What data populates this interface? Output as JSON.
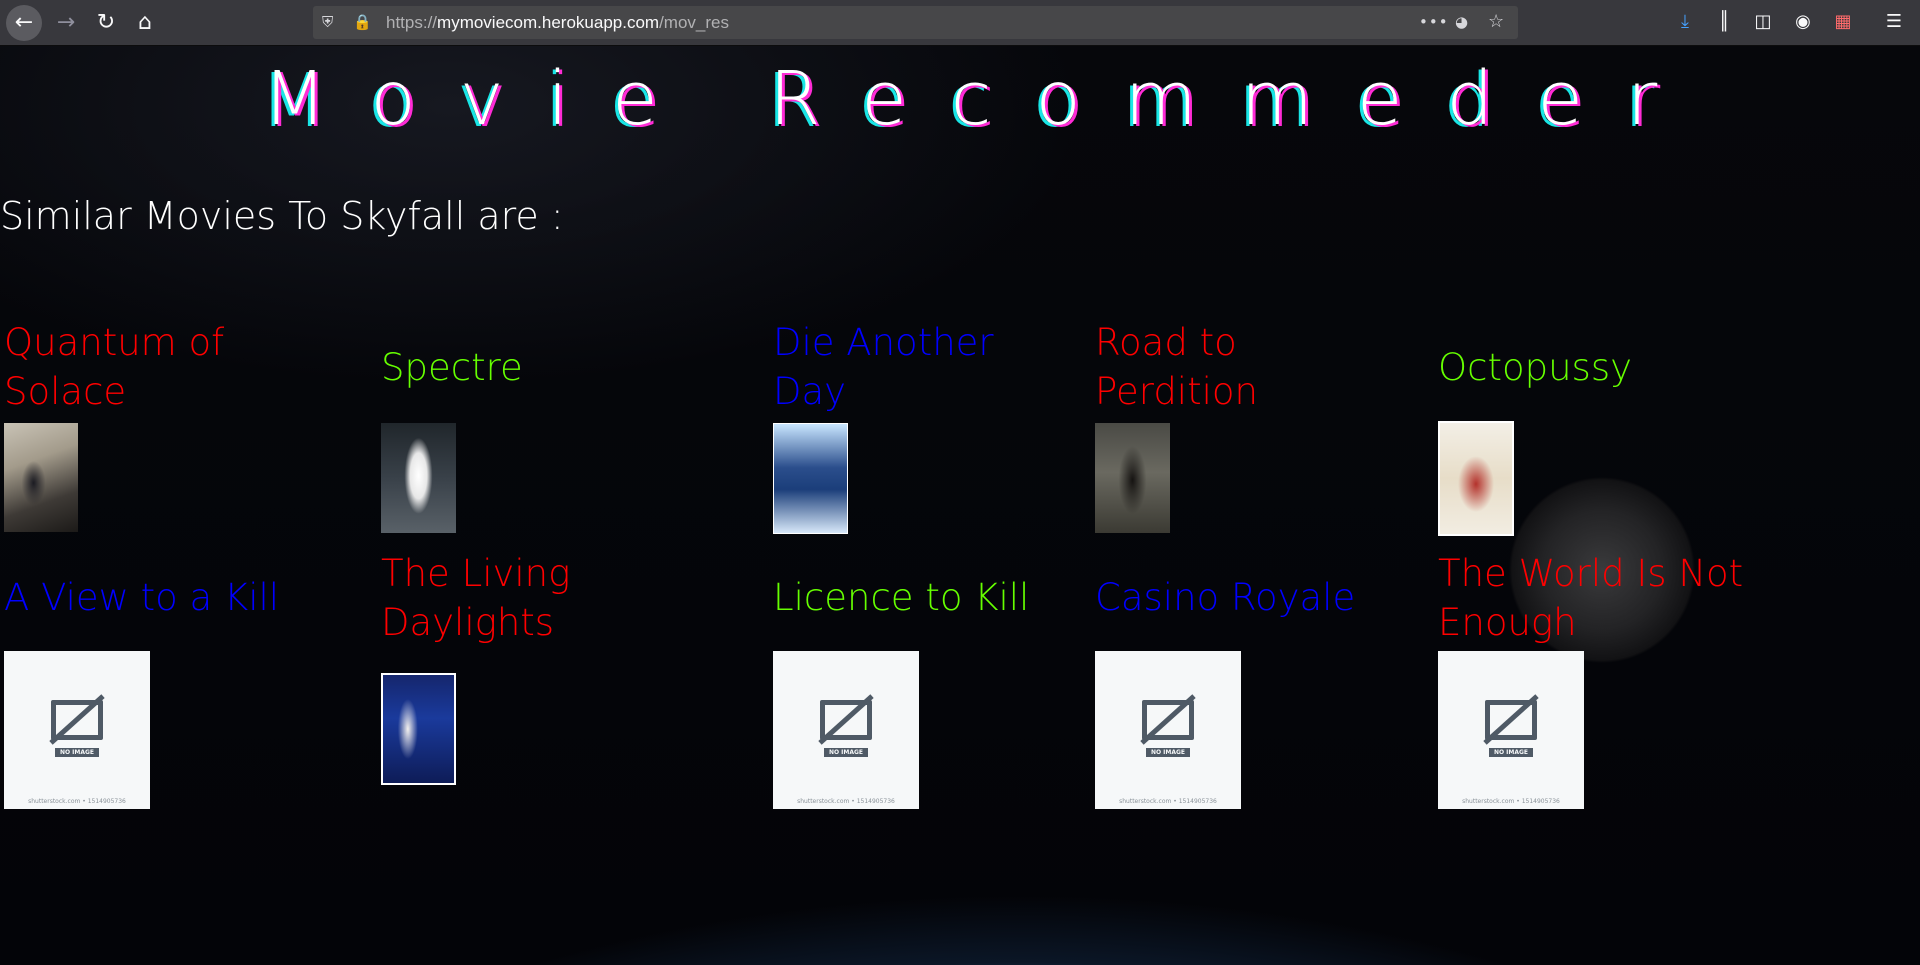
{
  "browser": {
    "url_scheme": "https://",
    "url_host": "mymoviecom.herokuapp.com",
    "url_path": "/mov_res",
    "icons": {
      "back": "back-arrow-icon",
      "forward": "forward-arrow-icon",
      "reload": "reload-icon",
      "home": "home-icon",
      "shield": "tracking-protection-shield-icon",
      "lock": "lock-icon",
      "more": "more-actions-icon",
      "pocket": "pocket-icon",
      "bookmark": "star-icon",
      "download": "download-icon",
      "library": "library-icon",
      "sidebar": "sidebar-icon",
      "account": "account-icon",
      "screenshot": "screenshot-icon",
      "menu": "hamburger-menu-icon"
    }
  },
  "page": {
    "title": "Movie Recommeder",
    "subtitle": "Similar Movies To Skyfall are :",
    "movies": [
      {
        "title": "Quantum of Solace",
        "color": "#ff0000",
        "poster": "image"
      },
      {
        "title": "Spectre",
        "color": "#66ff00",
        "poster": "image"
      },
      {
        "title": "Die Another Day",
        "color": "#0000ff",
        "poster": "image"
      },
      {
        "title": "Road to Perdition",
        "color": "#ff0000",
        "poster": "image"
      },
      {
        "title": "Octopussy",
        "color": "#66ff00",
        "poster": "image"
      },
      {
        "title": "A View to a Kill",
        "color": "#0000ff",
        "poster": "no-image"
      },
      {
        "title": "The Living Daylights",
        "color": "#ff0000",
        "poster": "image"
      },
      {
        "title": "Licence to Kill",
        "color": "#66ff00",
        "poster": "no-image"
      },
      {
        "title": "Casino Royale",
        "color": "#0000ff",
        "poster": "no-image"
      },
      {
        "title": "The World Is Not Enough",
        "color": "#ff0000",
        "poster": "no-image"
      }
    ],
    "no_image": {
      "label": "NO IMAGE",
      "footer": "shutterstock.com • 1514905736"
    }
  }
}
